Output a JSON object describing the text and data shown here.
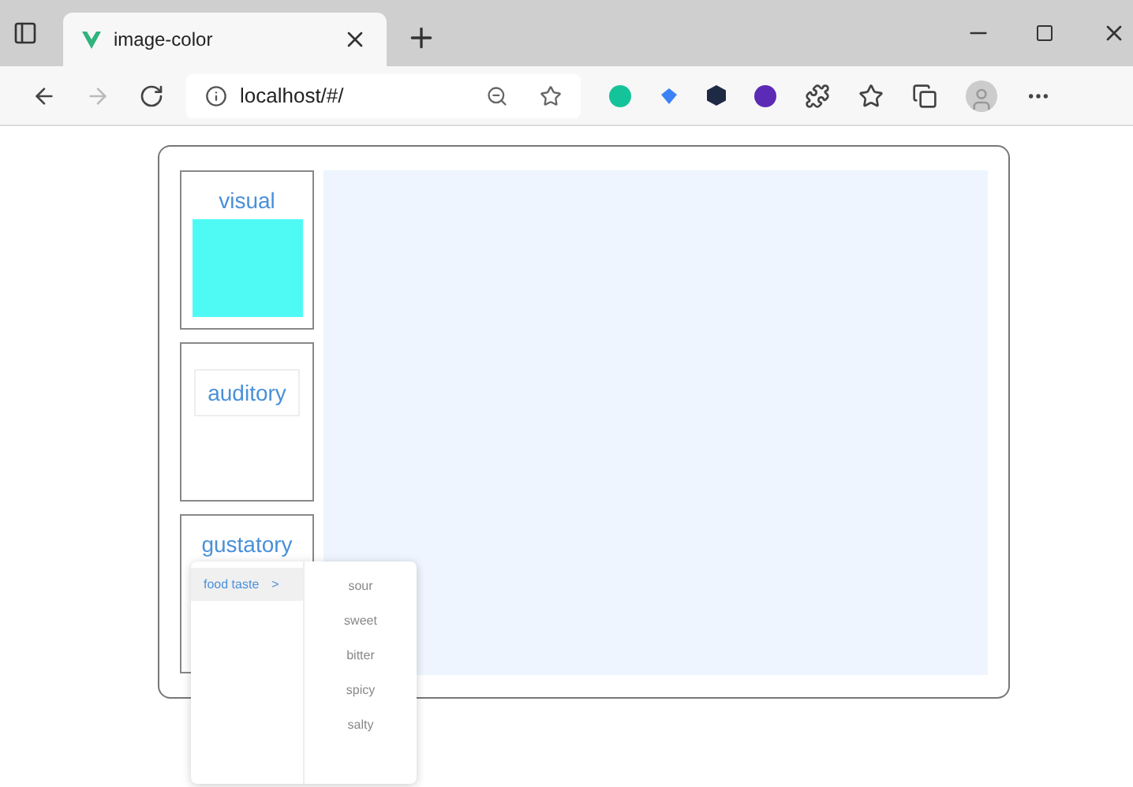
{
  "browser": {
    "tab_title": "image-color",
    "address": "localhost/#/"
  },
  "senses": [
    {
      "kind": "swatch",
      "label": "visual",
      "color": "#4ffaf5"
    },
    {
      "kind": "boxed",
      "label": "auditory"
    },
    {
      "kind": "menu",
      "label": "gustatory"
    }
  ],
  "menu": {
    "groups": [
      {
        "label": "food taste",
        "arrow": ">",
        "selected": true
      }
    ],
    "items": [
      "sour",
      "sweet",
      "bitter",
      "spicy",
      "salty"
    ]
  }
}
